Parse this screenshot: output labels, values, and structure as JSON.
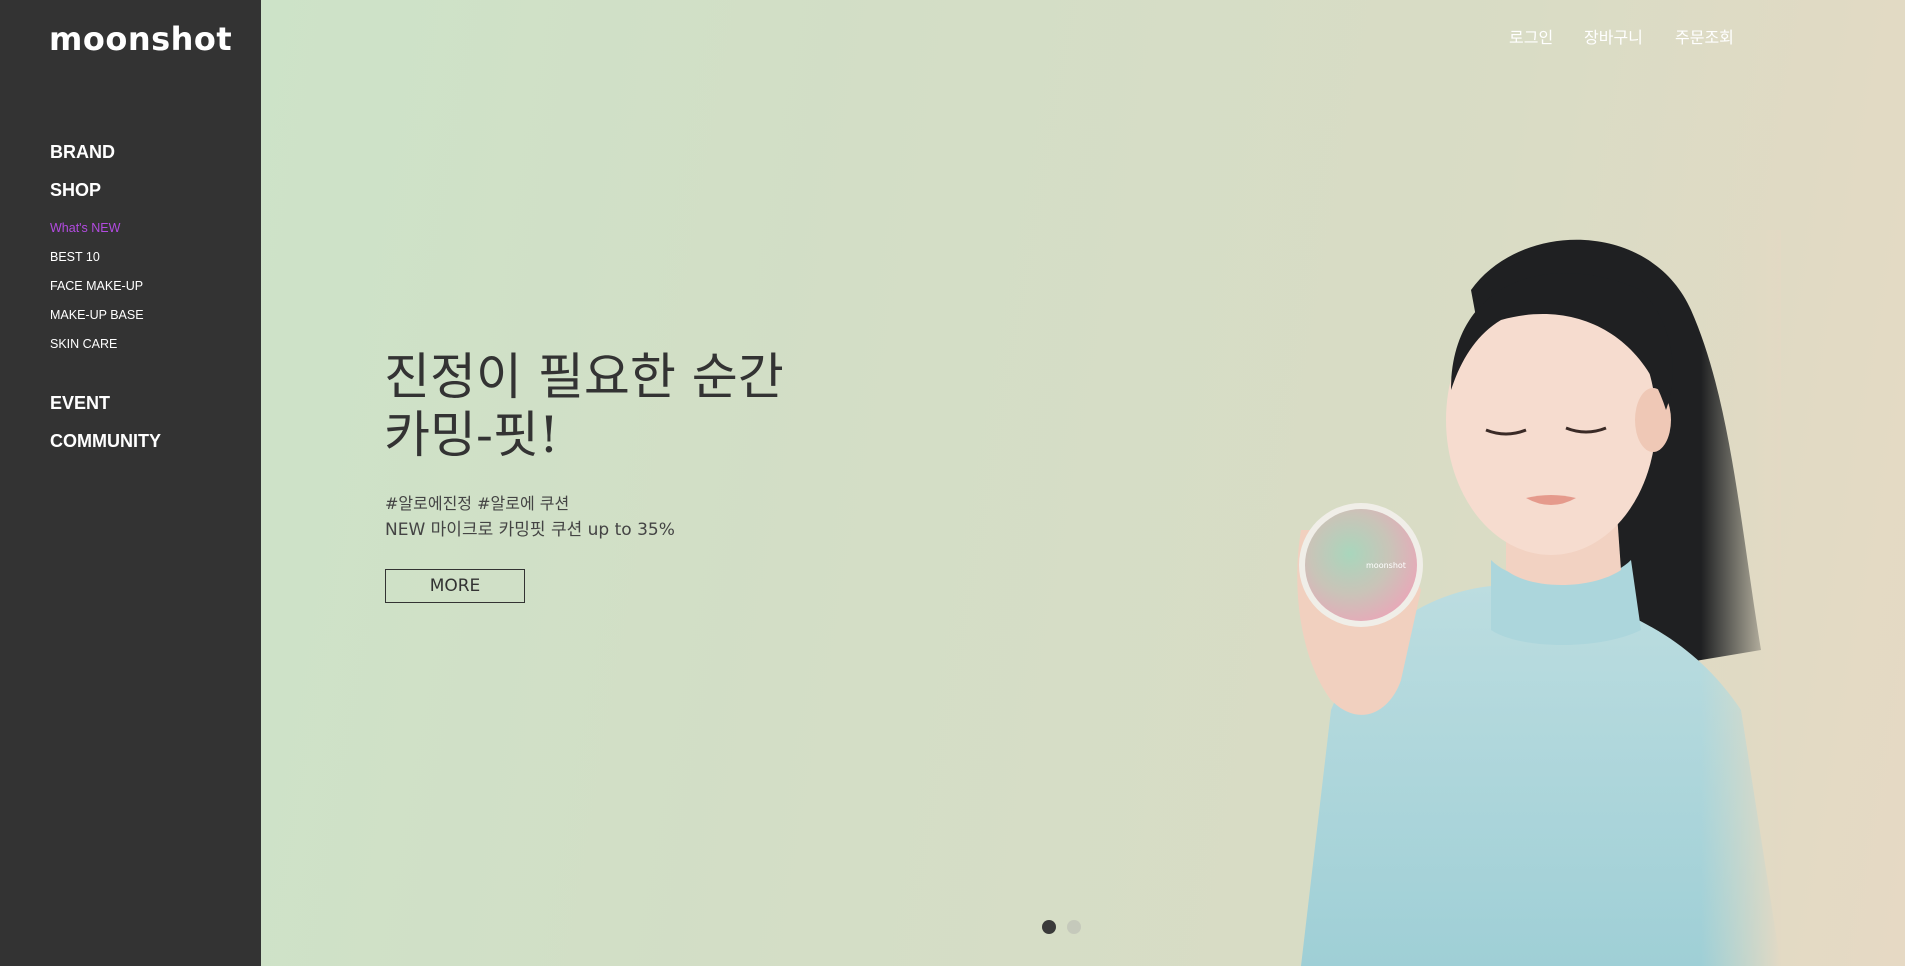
{
  "brand": {
    "logo": "moonshot"
  },
  "sidebar": {
    "main_items": [
      {
        "label": "BRAND"
      },
      {
        "label": "SHOP"
      },
      {
        "label": "EVENT"
      },
      {
        "label": "COMMUNITY"
      }
    ],
    "shop_items": [
      {
        "label": "What's NEW",
        "active": true
      },
      {
        "label": "BEST 10"
      },
      {
        "label": "FACE MAKE-UP"
      },
      {
        "label": "MAKE-UP BASE"
      },
      {
        "label": "SKIN CARE"
      }
    ]
  },
  "header": {
    "links": [
      {
        "label": "로그인"
      },
      {
        "label": "장바구니"
      },
      {
        "label": "주문조회"
      }
    ]
  },
  "hero": {
    "headline_line1": "진정이 필요한 순간",
    "headline_line2": "카밍-핏!",
    "tags": "#알로에진정 #알로에 쿠션",
    "promo": "NEW 마이크로 카밍핏 쿠션 up to 35%",
    "more_label": "MORE",
    "slides_total": 2,
    "slide_active": 1,
    "product_label": "moonshot"
  },
  "colors": {
    "sidebar_bg": "#333333",
    "active_nav": "#b24be0",
    "hero_bg_start": "#cde3c8",
    "hero_bg_end": "#e6d9c4",
    "text_dark": "#333333"
  },
  "icons": {
    "slide_dot": "circle"
  }
}
